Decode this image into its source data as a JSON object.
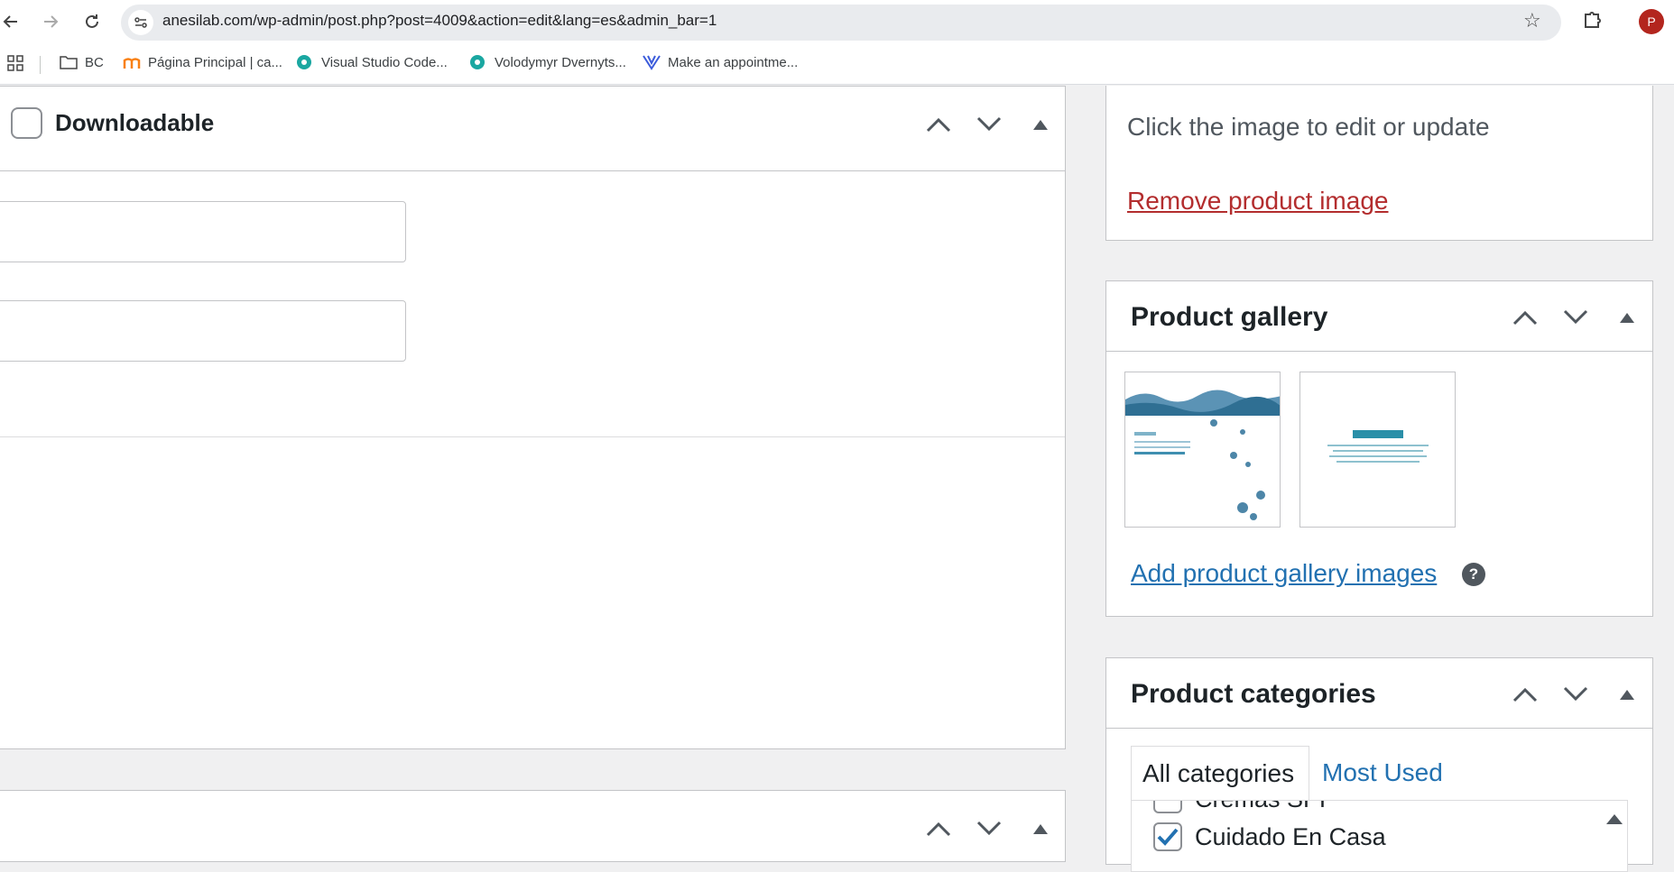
{
  "browser": {
    "url": "anesilab.com/wp-admin/post.php?post=4009&action=edit&lang=es&admin_bar=1",
    "profile_initial": "P"
  },
  "bookmarks": [
    {
      "label": "BC"
    },
    {
      "label": "Página Principal | ca..."
    },
    {
      "label": "Visual Studio Code..."
    },
    {
      "label": "Volodymyr Dvernyts..."
    },
    {
      "label": "Make an appointme..."
    }
  ],
  "product_data": {
    "downloadable_label": "Downloadable"
  },
  "product_image": {
    "hint": "Click the image to edit or update",
    "remove_link": "Remove product image"
  },
  "product_gallery": {
    "title": "Product gallery",
    "add_link": "Add product gallery images",
    "help_symbol": "?"
  },
  "product_categories": {
    "title": "Product categories",
    "tabs": [
      "All categories",
      "Most Used"
    ],
    "items": [
      {
        "label": "Cremas SPF",
        "checked": false
      },
      {
        "label": "Cuidado En Casa",
        "checked": true
      }
    ]
  },
  "colors": {
    "link": "#2271b1",
    "remove": "#b32d2e",
    "border": "#c3c4c7",
    "background": "#f0f0f1",
    "checkmark": "#2271b1"
  }
}
